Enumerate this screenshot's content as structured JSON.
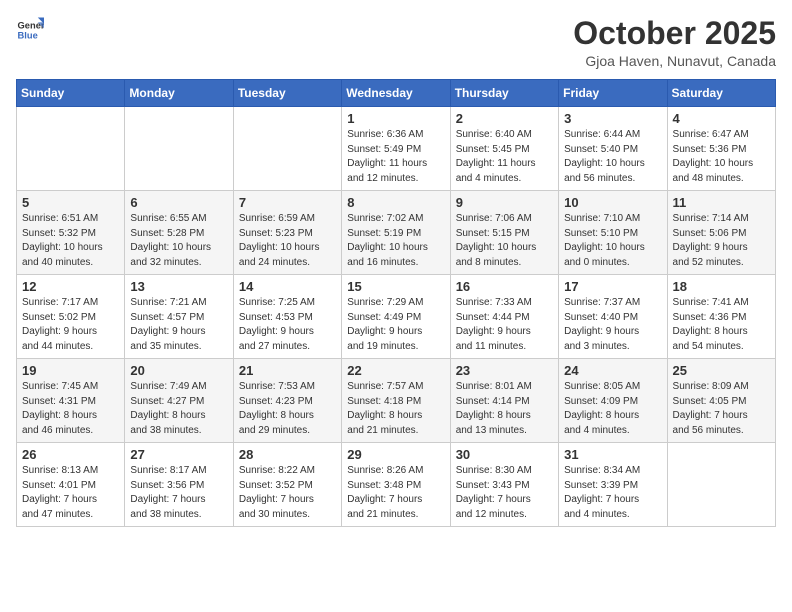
{
  "header": {
    "logo_general": "General",
    "logo_blue": "Blue",
    "month_title": "October 2025",
    "location": "Gjoa Haven, Nunavut, Canada"
  },
  "weekdays": [
    "Sunday",
    "Monday",
    "Tuesday",
    "Wednesday",
    "Thursday",
    "Friday",
    "Saturday"
  ],
  "weeks": [
    [
      {
        "day": "",
        "text": ""
      },
      {
        "day": "",
        "text": ""
      },
      {
        "day": "",
        "text": ""
      },
      {
        "day": "1",
        "text": "Sunrise: 6:36 AM\nSunset: 5:49 PM\nDaylight: 11 hours\nand 12 minutes."
      },
      {
        "day": "2",
        "text": "Sunrise: 6:40 AM\nSunset: 5:45 PM\nDaylight: 11 hours\nand 4 minutes."
      },
      {
        "day": "3",
        "text": "Sunrise: 6:44 AM\nSunset: 5:40 PM\nDaylight: 10 hours\nand 56 minutes."
      },
      {
        "day": "4",
        "text": "Sunrise: 6:47 AM\nSunset: 5:36 PM\nDaylight: 10 hours\nand 48 minutes."
      }
    ],
    [
      {
        "day": "5",
        "text": "Sunrise: 6:51 AM\nSunset: 5:32 PM\nDaylight: 10 hours\nand 40 minutes."
      },
      {
        "day": "6",
        "text": "Sunrise: 6:55 AM\nSunset: 5:28 PM\nDaylight: 10 hours\nand 32 minutes."
      },
      {
        "day": "7",
        "text": "Sunrise: 6:59 AM\nSunset: 5:23 PM\nDaylight: 10 hours\nand 24 minutes."
      },
      {
        "day": "8",
        "text": "Sunrise: 7:02 AM\nSunset: 5:19 PM\nDaylight: 10 hours\nand 16 minutes."
      },
      {
        "day": "9",
        "text": "Sunrise: 7:06 AM\nSunset: 5:15 PM\nDaylight: 10 hours\nand 8 minutes."
      },
      {
        "day": "10",
        "text": "Sunrise: 7:10 AM\nSunset: 5:10 PM\nDaylight: 10 hours\nand 0 minutes."
      },
      {
        "day": "11",
        "text": "Sunrise: 7:14 AM\nSunset: 5:06 PM\nDaylight: 9 hours\nand 52 minutes."
      }
    ],
    [
      {
        "day": "12",
        "text": "Sunrise: 7:17 AM\nSunset: 5:02 PM\nDaylight: 9 hours\nand 44 minutes."
      },
      {
        "day": "13",
        "text": "Sunrise: 7:21 AM\nSunset: 4:57 PM\nDaylight: 9 hours\nand 35 minutes."
      },
      {
        "day": "14",
        "text": "Sunrise: 7:25 AM\nSunset: 4:53 PM\nDaylight: 9 hours\nand 27 minutes."
      },
      {
        "day": "15",
        "text": "Sunrise: 7:29 AM\nSunset: 4:49 PM\nDaylight: 9 hours\nand 19 minutes."
      },
      {
        "day": "16",
        "text": "Sunrise: 7:33 AM\nSunset: 4:44 PM\nDaylight: 9 hours\nand 11 minutes."
      },
      {
        "day": "17",
        "text": "Sunrise: 7:37 AM\nSunset: 4:40 PM\nDaylight: 9 hours\nand 3 minutes."
      },
      {
        "day": "18",
        "text": "Sunrise: 7:41 AM\nSunset: 4:36 PM\nDaylight: 8 hours\nand 54 minutes."
      }
    ],
    [
      {
        "day": "19",
        "text": "Sunrise: 7:45 AM\nSunset: 4:31 PM\nDaylight: 8 hours\nand 46 minutes."
      },
      {
        "day": "20",
        "text": "Sunrise: 7:49 AM\nSunset: 4:27 PM\nDaylight: 8 hours\nand 38 minutes."
      },
      {
        "day": "21",
        "text": "Sunrise: 7:53 AM\nSunset: 4:23 PM\nDaylight: 8 hours\nand 29 minutes."
      },
      {
        "day": "22",
        "text": "Sunrise: 7:57 AM\nSunset: 4:18 PM\nDaylight: 8 hours\nand 21 minutes."
      },
      {
        "day": "23",
        "text": "Sunrise: 8:01 AM\nSunset: 4:14 PM\nDaylight: 8 hours\nand 13 minutes."
      },
      {
        "day": "24",
        "text": "Sunrise: 8:05 AM\nSunset: 4:09 PM\nDaylight: 8 hours\nand 4 minutes."
      },
      {
        "day": "25",
        "text": "Sunrise: 8:09 AM\nSunset: 4:05 PM\nDaylight: 7 hours\nand 56 minutes."
      }
    ],
    [
      {
        "day": "26",
        "text": "Sunrise: 8:13 AM\nSunset: 4:01 PM\nDaylight: 7 hours\nand 47 minutes."
      },
      {
        "day": "27",
        "text": "Sunrise: 8:17 AM\nSunset: 3:56 PM\nDaylight: 7 hours\nand 38 minutes."
      },
      {
        "day": "28",
        "text": "Sunrise: 8:22 AM\nSunset: 3:52 PM\nDaylight: 7 hours\nand 30 minutes."
      },
      {
        "day": "29",
        "text": "Sunrise: 8:26 AM\nSunset: 3:48 PM\nDaylight: 7 hours\nand 21 minutes."
      },
      {
        "day": "30",
        "text": "Sunrise: 8:30 AM\nSunset: 3:43 PM\nDaylight: 7 hours\nand 12 minutes."
      },
      {
        "day": "31",
        "text": "Sunrise: 8:34 AM\nSunset: 3:39 PM\nDaylight: 7 hours\nand 4 minutes."
      },
      {
        "day": "",
        "text": ""
      }
    ]
  ]
}
